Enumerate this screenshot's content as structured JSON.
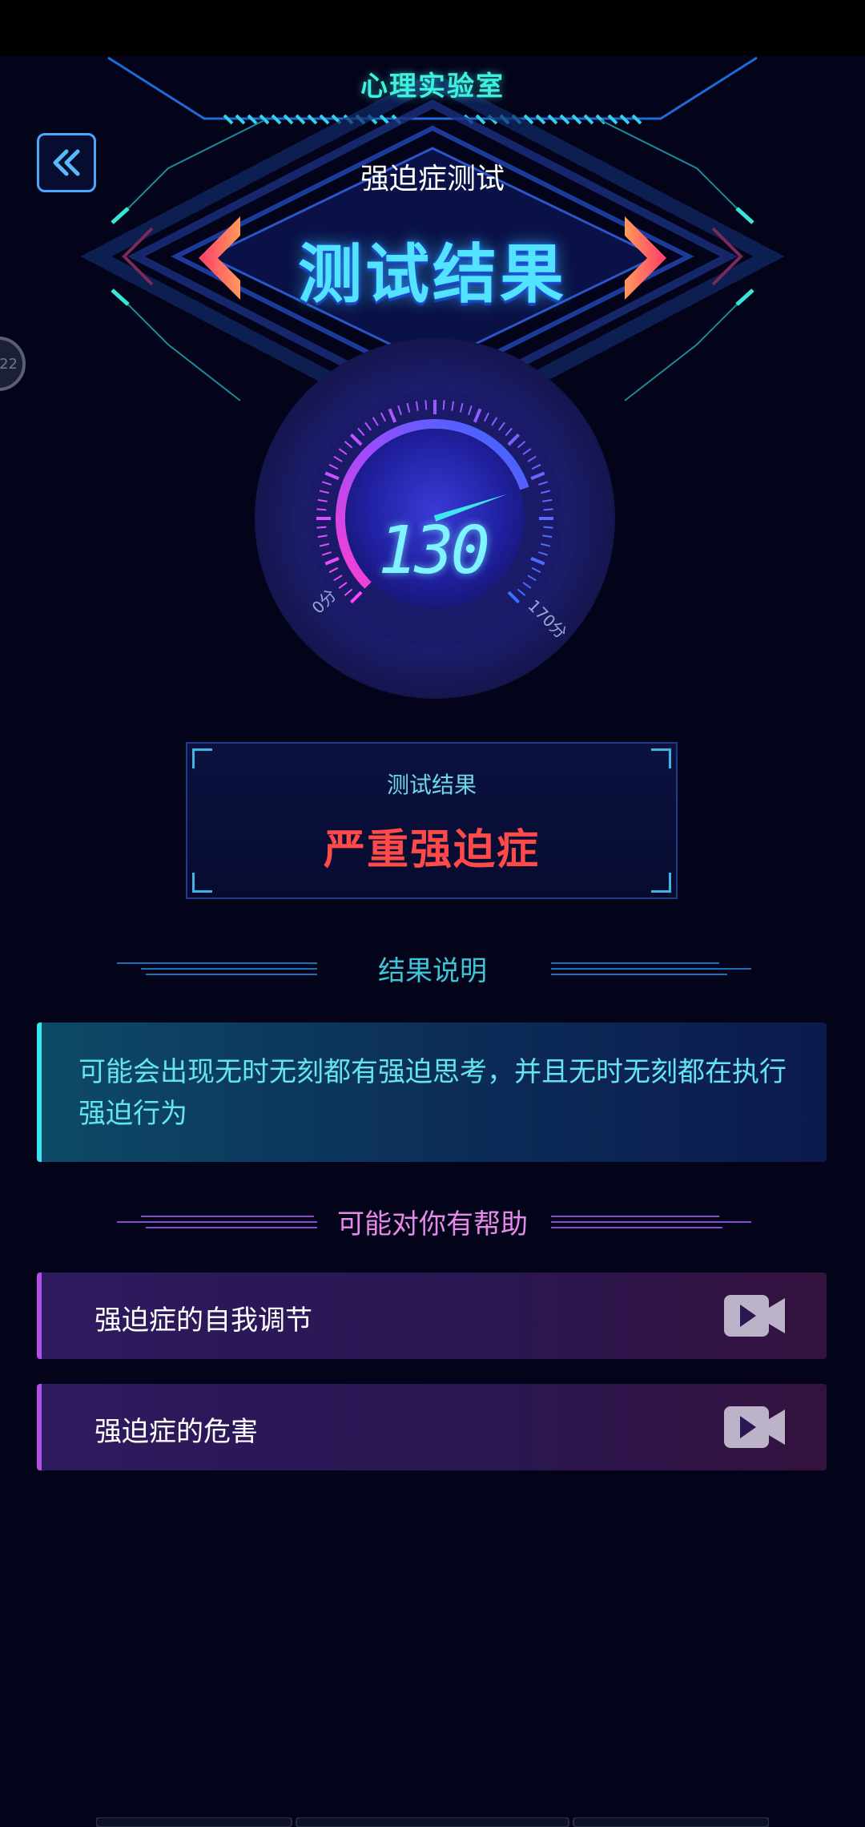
{
  "header": {
    "lab_title": "心理实验室",
    "test_name": "强迫症测试",
    "result_heading": "测试结果"
  },
  "side_bubble_text": "22",
  "gauge": {
    "value": "130",
    "min_label": "0分",
    "max_label": "170分",
    "max": 170,
    "score": 130
  },
  "result_box": {
    "label": "测试结果",
    "value": "严重强迫症"
  },
  "explanation": {
    "heading": "结果说明",
    "text": "可能会出现无时无刻都有强迫思考，并且无时无刻都在执行强迫行为"
  },
  "help": {
    "heading": "可能对你有帮助",
    "items": [
      {
        "label": "强迫症的自我调节",
        "icon": "video-camera-icon"
      },
      {
        "label": "强迫症的危害",
        "icon": "video-camera-icon"
      }
    ]
  },
  "colors": {
    "background": "#03041a",
    "accent_cyan": "#3ef0e0",
    "danger": "#ff4a4a",
    "purple": "#b54ee6"
  }
}
